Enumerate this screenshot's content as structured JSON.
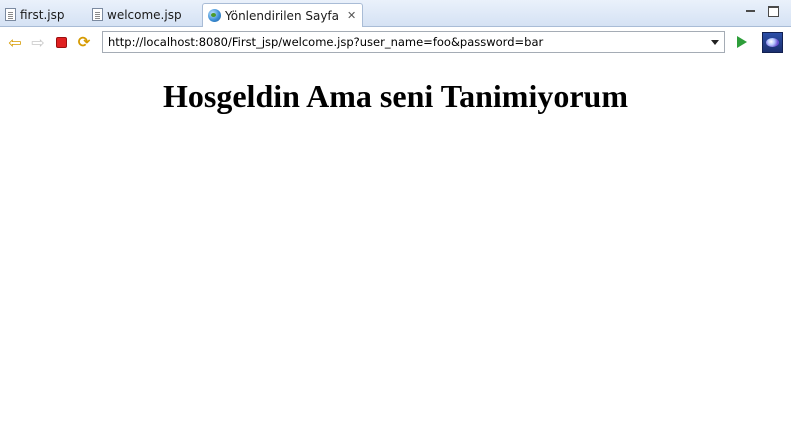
{
  "tabs": [
    {
      "label": "first.jsp",
      "icon": "jsp-file-icon",
      "active": false
    },
    {
      "label": "welcome.jsp",
      "icon": "jsp-file-icon",
      "active": false
    },
    {
      "label": "Yönlendirilen Sayfa",
      "icon": "globe-icon",
      "active": true
    }
  ],
  "window_controls": {
    "minimize_icon": "minimize-icon",
    "maximize_icon": "maximize-icon"
  },
  "toolbar": {
    "back_icon": "back-arrow-icon",
    "forward_icon": "forward-arrow-icon",
    "stop_icon": "stop-icon",
    "refresh_icon": "refresh-icon",
    "go_icon": "go-arrow-icon",
    "eclipse_icon": "eclipse-icon"
  },
  "address_bar": {
    "url": "http://localhost:8080/First_jsp/welcome.jsp?user_name=foo&password=bar"
  },
  "page": {
    "heading": "Hosgeldin Ama seni Tanimiyorum"
  },
  "colors": {
    "tabbar_bg": "#d5e2f4",
    "stop_red": "#e02020",
    "go_green": "#2e9e3a",
    "nav_arrow": "#d69a00"
  }
}
